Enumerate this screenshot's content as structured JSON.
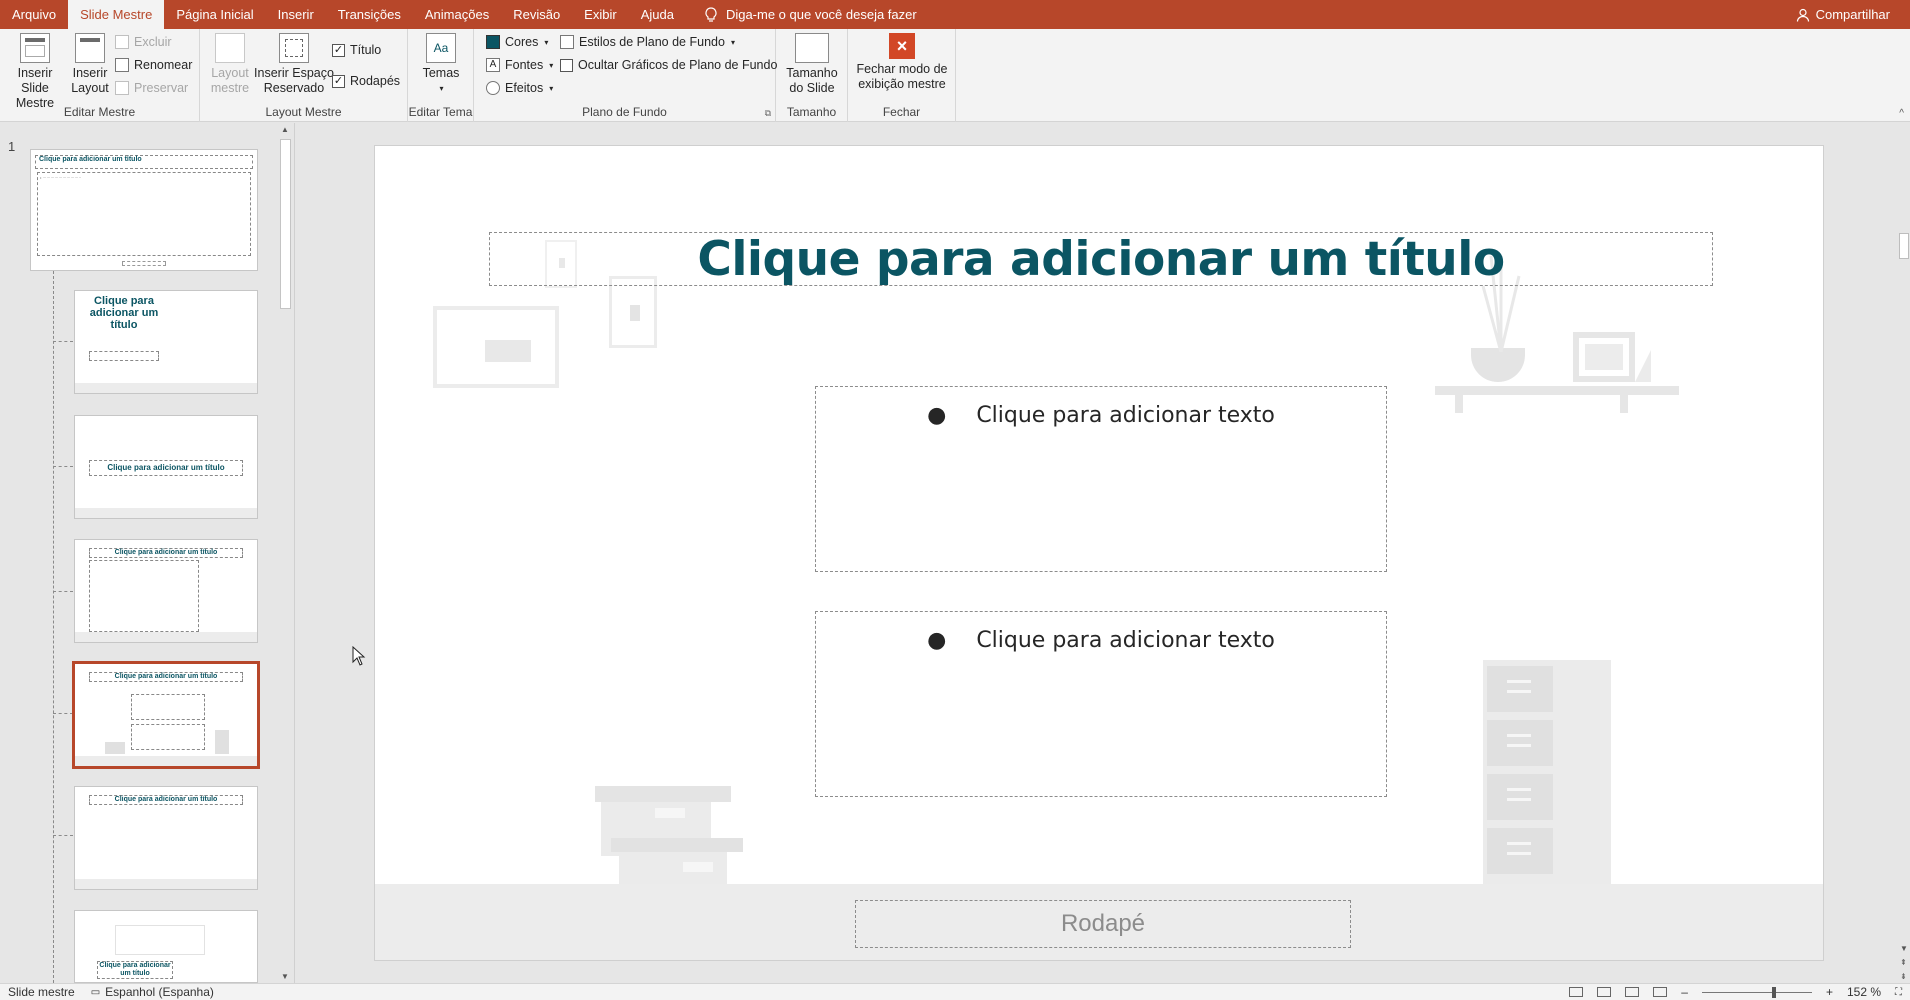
{
  "menu": {
    "tabs": [
      {
        "label": "Arquivo",
        "active": false
      },
      {
        "label": "Slide Mestre",
        "active": true
      },
      {
        "label": "Página Inicial",
        "active": false
      },
      {
        "label": "Inserir",
        "active": false
      },
      {
        "label": "Transições",
        "active": false
      },
      {
        "label": "Animações",
        "active": false
      },
      {
        "label": "Revisão",
        "active": false
      },
      {
        "label": "Exibir",
        "active": false
      },
      {
        "label": "Ajuda",
        "active": false
      }
    ],
    "tell_me": "Diga-me o que você deseja fazer",
    "share": "Compartilhar",
    "accent_color": "#b7472a"
  },
  "ribbon": {
    "editar_mestre": {
      "label": "Editar Mestre",
      "insert_slide_master": "Inserir Slide Mestre",
      "insert_layout": "Inserir Layout",
      "delete": "Excluir",
      "rename": "Renomear",
      "preserve": "Preservar"
    },
    "layout_mestre": {
      "label": "Layout Mestre",
      "layout_master": "Layout mestre",
      "insert_placeholder": "Inserir Espaço Reservado",
      "title_check": "Título",
      "footer_check": "Rodapés"
    },
    "editar_tema": {
      "label": "Editar Tema",
      "themes": "Temas"
    },
    "plano_de_fundo": {
      "label": "Plano de Fundo",
      "colors": "Cores",
      "fonts": "Fontes",
      "effects": "Efeitos",
      "bg_styles": "Estilos de Plano de Fundo",
      "hide_bg_graphics": "Ocultar Gráficos de Plano de Fundo"
    },
    "tamanho": {
      "label": "Tamanho",
      "slide_size": "Tamanho do Slide"
    },
    "fechar": {
      "label": "Fechar",
      "close_master": "Fechar modo de exibição mestre"
    }
  },
  "thumbnails": {
    "master_number": "1",
    "master_title": "Clique para adicionar um título",
    "layout_2_title": "Clique para adicionar um título",
    "layout_3_title": "Clique para adicionar um título",
    "layout_4_title": "Clique para adicionar um título",
    "layout_5_title": "Clique para adicionar um título",
    "layout_6_title": "Clique para adicionar um título",
    "layout_7_title": "Clique para adicionar um título"
  },
  "slide": {
    "title": "Clique para adicionar um título",
    "body_1": "Clique para adicionar texto",
    "body_2": "Clique para adicionar texto",
    "footer": "Rodapé",
    "title_color": "#0b5563"
  },
  "status": {
    "view": "Slide mestre",
    "language": "Espanhol (Espanha)",
    "zoom": "152 %"
  }
}
